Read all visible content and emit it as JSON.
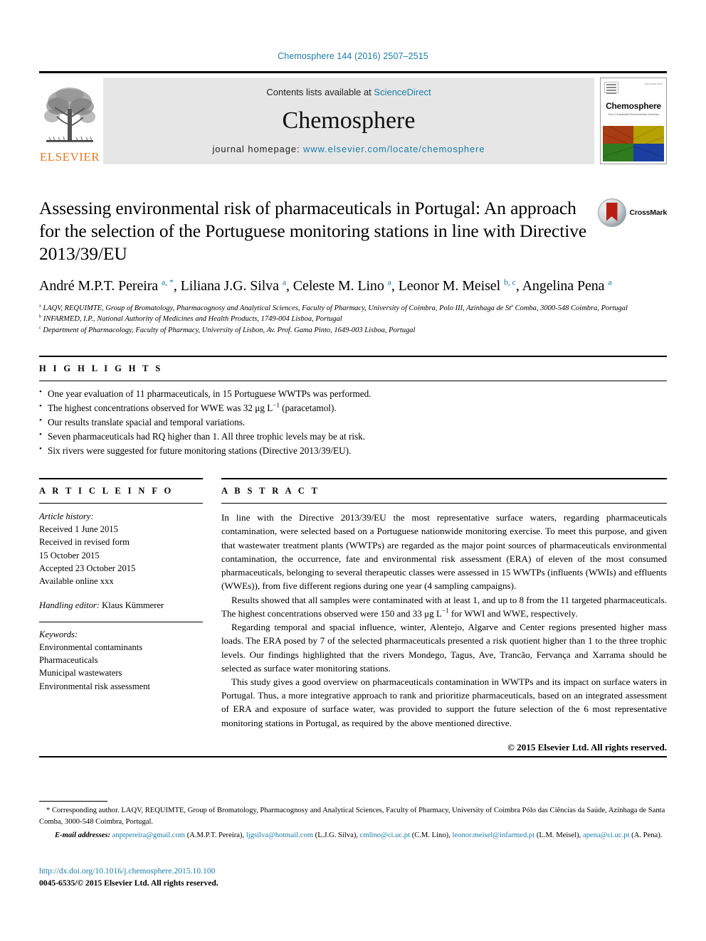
{
  "running_head": "Chemosphere 144 (2016) 2507–2515",
  "masthead": {
    "publisher_name": "ELSEVIER",
    "contents_prefix": "Contents lists available at ",
    "contents_link": "ScienceDirect",
    "journal_name": "Chemosphere",
    "homepage_prefix": "journal homepage: ",
    "homepage_url": "www.elsevier.com/locate/chemosphere",
    "cover": {
      "title": "Chemosphere",
      "subtitle": "Your in Sustainable Environmental Chemistry",
      "issn_text": "ISSN 0045-6535"
    }
  },
  "article": {
    "title": "Assessing environmental risk of pharmaceuticals in Portugal: An approach for the selection of the Portuguese monitoring stations in line with Directive 2013/39/EU",
    "crossmark_label": "CrossMark",
    "authors_html": "André M.P.T. Pereira <sup>a, *</sup>, Liliana J.G. Silva <sup>a</sup>, Celeste M. Lino <sup>a</sup>, Leonor M. Meisel <sup>b, c</sup>, Angelina Pena <sup>a</sup>",
    "affiliations": [
      "<sup>a</sup> LAQV, REQUIMTE, Group of Bromatology, Pharmacognosy and Analytical Sciences, Faculty of Pharmacy, University of Coimbra, Polo III, Azinhaga de St<sup>a</sup> Comba, 3000-548 Coimbra, Portugal",
      "<sup>b</sup> INFARMED, I.P., National Authority of Medicines and Health Products, 1749-004 Lisboa, Portugal",
      "<sup>c</sup> Department of Pharmacology, Faculty of Pharmacy, University of Lisbon, Av. Prof. Gama Pinto, 1649-003 Lisboa, Portugal"
    ]
  },
  "highlights": {
    "heading": "H I G H L I G H T S",
    "items": [
      "One year evaluation of 11 pharmaceuticals, in 15 Portuguese WWTPs was performed.",
      "The highest concentrations observed for WWE was 32 μg L<sup>−1</sup> (paracetamol).",
      "Our results translate spacial and temporal variations.",
      "Seven pharmaceuticals had RQ higher than 1. All three trophic levels may be at risk.",
      "Six rivers were suggested for future monitoring stations (Directive 2013/39/EU)."
    ]
  },
  "article_info": {
    "heading": "A R T I C L E   I N F O",
    "history_label": "Article history:",
    "history": [
      "Received 1 June 2015",
      "Received in revised form",
      "15 October 2015",
      "Accepted 23 October 2015",
      "Available online xxx"
    ],
    "handling_editor_label": "Handling editor:",
    "handling_editor": "Klaus Kümmerer",
    "keywords_label": "Keywords:",
    "keywords": [
      "Environmental contaminants",
      "Pharmaceuticals",
      "Municipal wastewaters",
      "Environmental risk assessment"
    ]
  },
  "abstract": {
    "heading": "A B S T R A C T",
    "paragraphs": [
      "In line with the Directive 2013/39/EU the most representative surface waters, regarding pharmaceuticals contamination, were selected based on a Portuguese nationwide monitoring exercise. To meet this purpose, and given that wastewater treatment plants (WWTPs) are regarded as the major point sources of pharmaceuticals environmental contamination, the occurrence, fate and environmental risk assessment (ERA) of eleven of the most consumed pharmaceuticals, belonging to several therapeutic classes were assessed in 15 WWTPs (influents (WWIs) and effluents (WWEs)), from five different regions during one year (4 sampling campaigns).",
      "Results showed that all samples were contaminated with at least 1, and up to 8 from the 11 targeted pharmaceuticals. The highest concentrations observed were 150 and 33 μg L<sup>−1</sup> for WWI and WWE, respectively.",
      "Regarding temporal and spacial influence, winter, Alentejo, Algarve and Center regions presented higher mass loads. The ERA posed by 7 of the selected pharmaceuticals presented a risk quotient higher than 1 to the three trophic levels. Our findings highlighted that the rivers Mondego, Tagus, Ave, Trancão, Fervança and Xarrama should be selected as surface water monitoring stations.",
      "This study gives a good overview on pharmaceuticals contamination in WWTPs and its impact on surface waters in Portugal. Thus, a more integrative approach to rank and prioritize pharmaceuticals, based on an integrated assessment of ERA and exposure of surface water, was provided to support the future selection of the 6 most representative monitoring stations in Portugal, as required by the above mentioned directive."
    ],
    "copyright": "© 2015 Elsevier Ltd. All rights reserved."
  },
  "footnotes": {
    "corresponding": "* Corresponding author. LAQV, REQUIMTE, Group of Bromatology, Pharmacognosy and Analytical Sciences, Faculty of Pharmacy, University of Coimbra Pólo das Ciências da Saúde, Azinhaga de Santa Comba, 3000-548 Coimbra, Portugal.",
    "emails_label": "E-mail addresses:",
    "emails": [
      {
        "address": "anptpereira@gmail.com",
        "owner": "(A.M.P.T. Pereira)"
      },
      {
        "address": "ljgsilva@hotmail.com",
        "owner": "(L.J.G. Silva)"
      },
      {
        "address": "cmlino@ci.uc.pt",
        "owner": "(C.M. Lino)"
      },
      {
        "address": "leonor.meisel@infarmed.pt",
        "owner": "(L.M. Meisel)"
      },
      {
        "address": "apena@ci.uc.pt",
        "owner": "(A. Pena)"
      }
    ]
  },
  "doi": {
    "url": "http://dx.doi.org/10.1016/j.chemosphere.2015.10.100",
    "issn_line": "0045-6535/© 2015 Elsevier Ltd. All rights reserved."
  },
  "colors": {
    "link_blue": "#1a7ca8",
    "elsevier_orange": "#E87722",
    "masthead_grey": "#e6e6e6",
    "crossmark_red": "#b81f12"
  }
}
